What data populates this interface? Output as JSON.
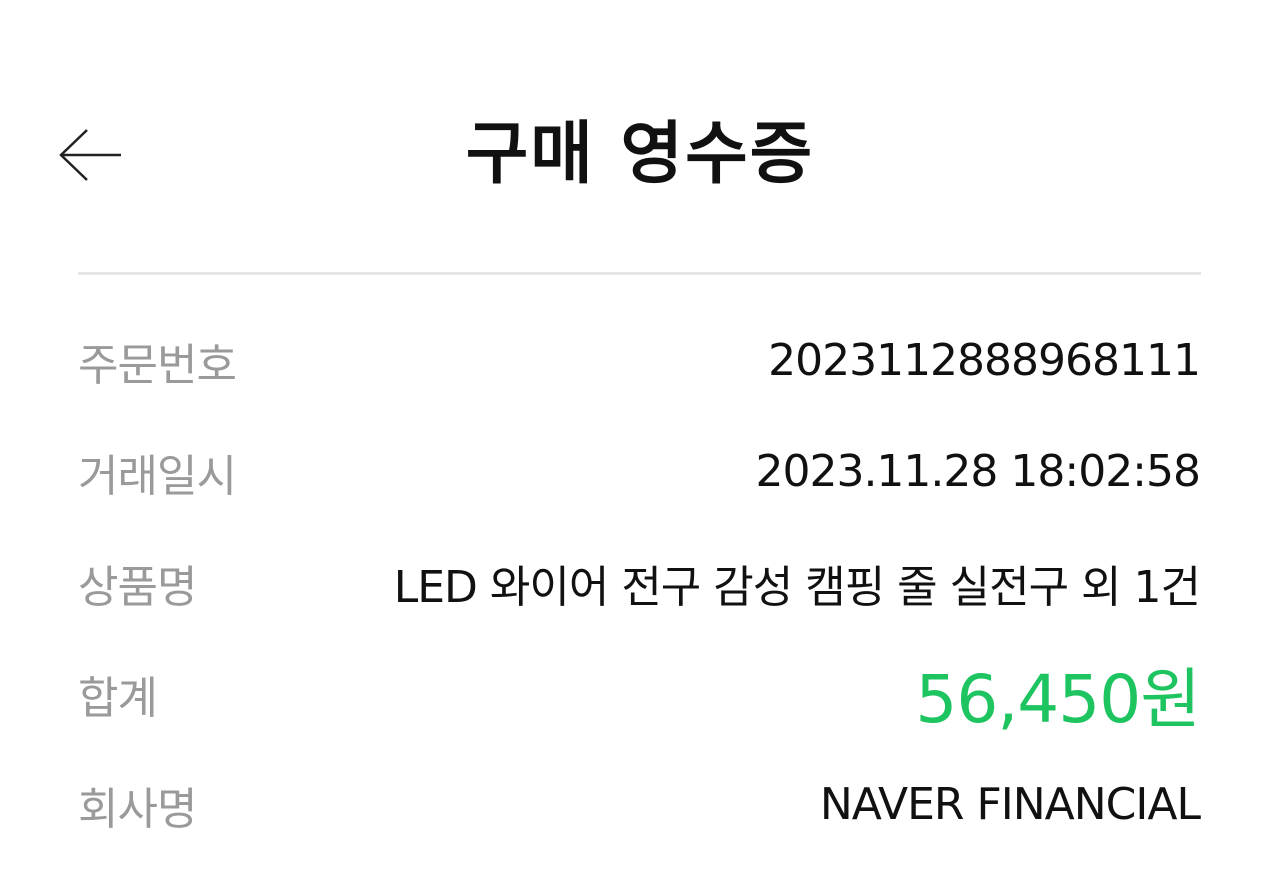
{
  "header": {
    "title": "구매 영수증"
  },
  "icons": {
    "back": "arrow-left-icon"
  },
  "colors": {
    "total_accent": "#1ec460",
    "label_gray": "#9a9a9a"
  },
  "receipt": {
    "rows": [
      {
        "label": "주문번호",
        "value": "2023112888968111"
      },
      {
        "label": "거래일시",
        "value": "2023.11.28 18:02:58"
      },
      {
        "label": "상품명",
        "value": "LED 와이어 전구 감성 캠핑 줄 실전구 외 1건"
      },
      {
        "label": "합계",
        "value": "56,450원"
      },
      {
        "label": "회사명",
        "value": "NAVER FINANCIAL"
      }
    ]
  }
}
